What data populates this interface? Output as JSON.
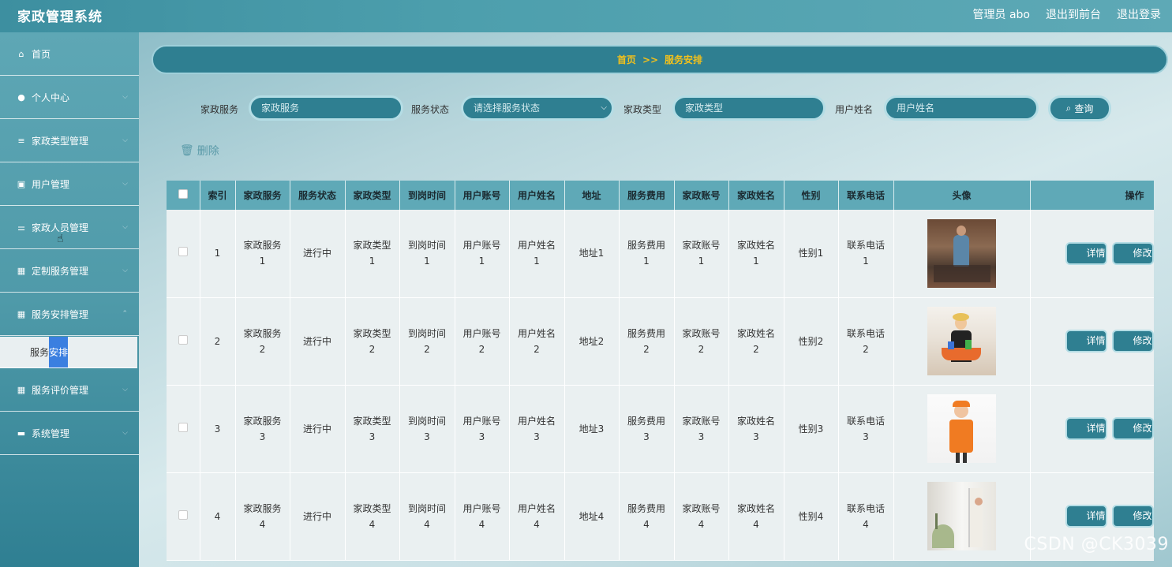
{
  "header": {
    "title": "家政管理系统",
    "admin": "管理员 abo",
    "to_front": "退出到前台",
    "logout": "退出登录"
  },
  "sidebar": {
    "items": [
      {
        "label": "首页",
        "icon": "home-icon"
      },
      {
        "label": "个人中心",
        "icon": "user-icon"
      },
      {
        "label": "家政类型管理",
        "icon": "list-icon"
      },
      {
        "label": "用户管理",
        "icon": "edit-icon"
      },
      {
        "label": "家政人员管理",
        "icon": "sliders-icon"
      },
      {
        "label": "定制服务管理",
        "icon": "grid-icon"
      },
      {
        "label": "服务安排管理",
        "icon": "grid-icon"
      }
    ],
    "submenu_a": "服务",
    "submenu_b": "安排",
    "items_after": [
      {
        "label": "服务评价管理",
        "icon": "grid-icon"
      },
      {
        "label": "系统管理",
        "icon": "monitor-icon"
      }
    ]
  },
  "breadcrumb": {
    "home": "首页",
    "sep": ">>",
    "current": "服务安排"
  },
  "search": {
    "service_label": "家政服务",
    "service_ph": "家政服务",
    "status_label": "服务状态",
    "status_ph": "请选择服务状态",
    "type_label": "家政类型",
    "type_ph": "家政类型",
    "user_label": "用户姓名",
    "user_ph": "用户姓名",
    "query": "查询"
  },
  "delete_label": "删除",
  "table": {
    "headers": [
      "索引",
      "家政服务",
      "服务状态",
      "家政类型",
      "到岗时间",
      "用户账号",
      "用户姓名",
      "地址",
      "服务费用",
      "家政账号",
      "家政姓名",
      "性别",
      "联系电话",
      "头像",
      "操作"
    ],
    "detail": "详情",
    "edit": "修改",
    "rows": [
      {
        "idx": "1",
        "c1a": "家政服务",
        "c1b": "1",
        "status": "进行中",
        "c3a": "家政类型",
        "c3b": "1",
        "c4a": "到岗时间",
        "c4b": "1",
        "c5a": "用户账号",
        "c5b": "1",
        "c6a": "用户姓名",
        "c6b": "1",
        "addr": "地址1",
        "c8a": "服务费用",
        "c8b": "1",
        "c9a": "家政账号",
        "c9b": "1",
        "c10a": "家政姓名",
        "c10b": "1",
        "sex": "性别1",
        "c12a": "联系电话",
        "c12b": "1"
      },
      {
        "idx": "2",
        "c1a": "家政服务",
        "c1b": "2",
        "status": "进行中",
        "c3a": "家政类型",
        "c3b": "2",
        "c4a": "到岗时间",
        "c4b": "2",
        "c5a": "用户账号",
        "c5b": "2",
        "c6a": "用户姓名",
        "c6b": "2",
        "addr": "地址2",
        "c8a": "服务费用",
        "c8b": "2",
        "c9a": "家政账号",
        "c9b": "2",
        "c10a": "家政姓名",
        "c10b": "2",
        "sex": "性别2",
        "c12a": "联系电话",
        "c12b": "2"
      },
      {
        "idx": "3",
        "c1a": "家政服务",
        "c1b": "3",
        "status": "进行中",
        "c3a": "家政类型",
        "c3b": "3",
        "c4a": "到岗时间",
        "c4b": "3",
        "c5a": "用户账号",
        "c5b": "3",
        "c6a": "用户姓名",
        "c6b": "3",
        "addr": "地址3",
        "c8a": "服务费用",
        "c8b": "3",
        "c9a": "家政账号",
        "c9b": "3",
        "c10a": "家政姓名",
        "c10b": "3",
        "sex": "性别3",
        "c12a": "联系电话",
        "c12b": "3"
      },
      {
        "idx": "4",
        "c1a": "家政服务",
        "c1b": "4",
        "status": "进行中",
        "c3a": "家政类型",
        "c3b": "4",
        "c4a": "到岗时间",
        "c4b": "4",
        "c5a": "用户账号",
        "c5b": "4",
        "c6a": "用户姓名",
        "c6b": "4",
        "addr": "地址4",
        "c8a": "服务费用",
        "c8b": "4",
        "c9a": "家政账号",
        "c9b": "4",
        "c10a": "家政姓名",
        "c10b": "4",
        "sex": "性别4",
        "c12a": "联系电话",
        "c12b": "4"
      }
    ]
  },
  "watermark": "CSDN @CK3039"
}
